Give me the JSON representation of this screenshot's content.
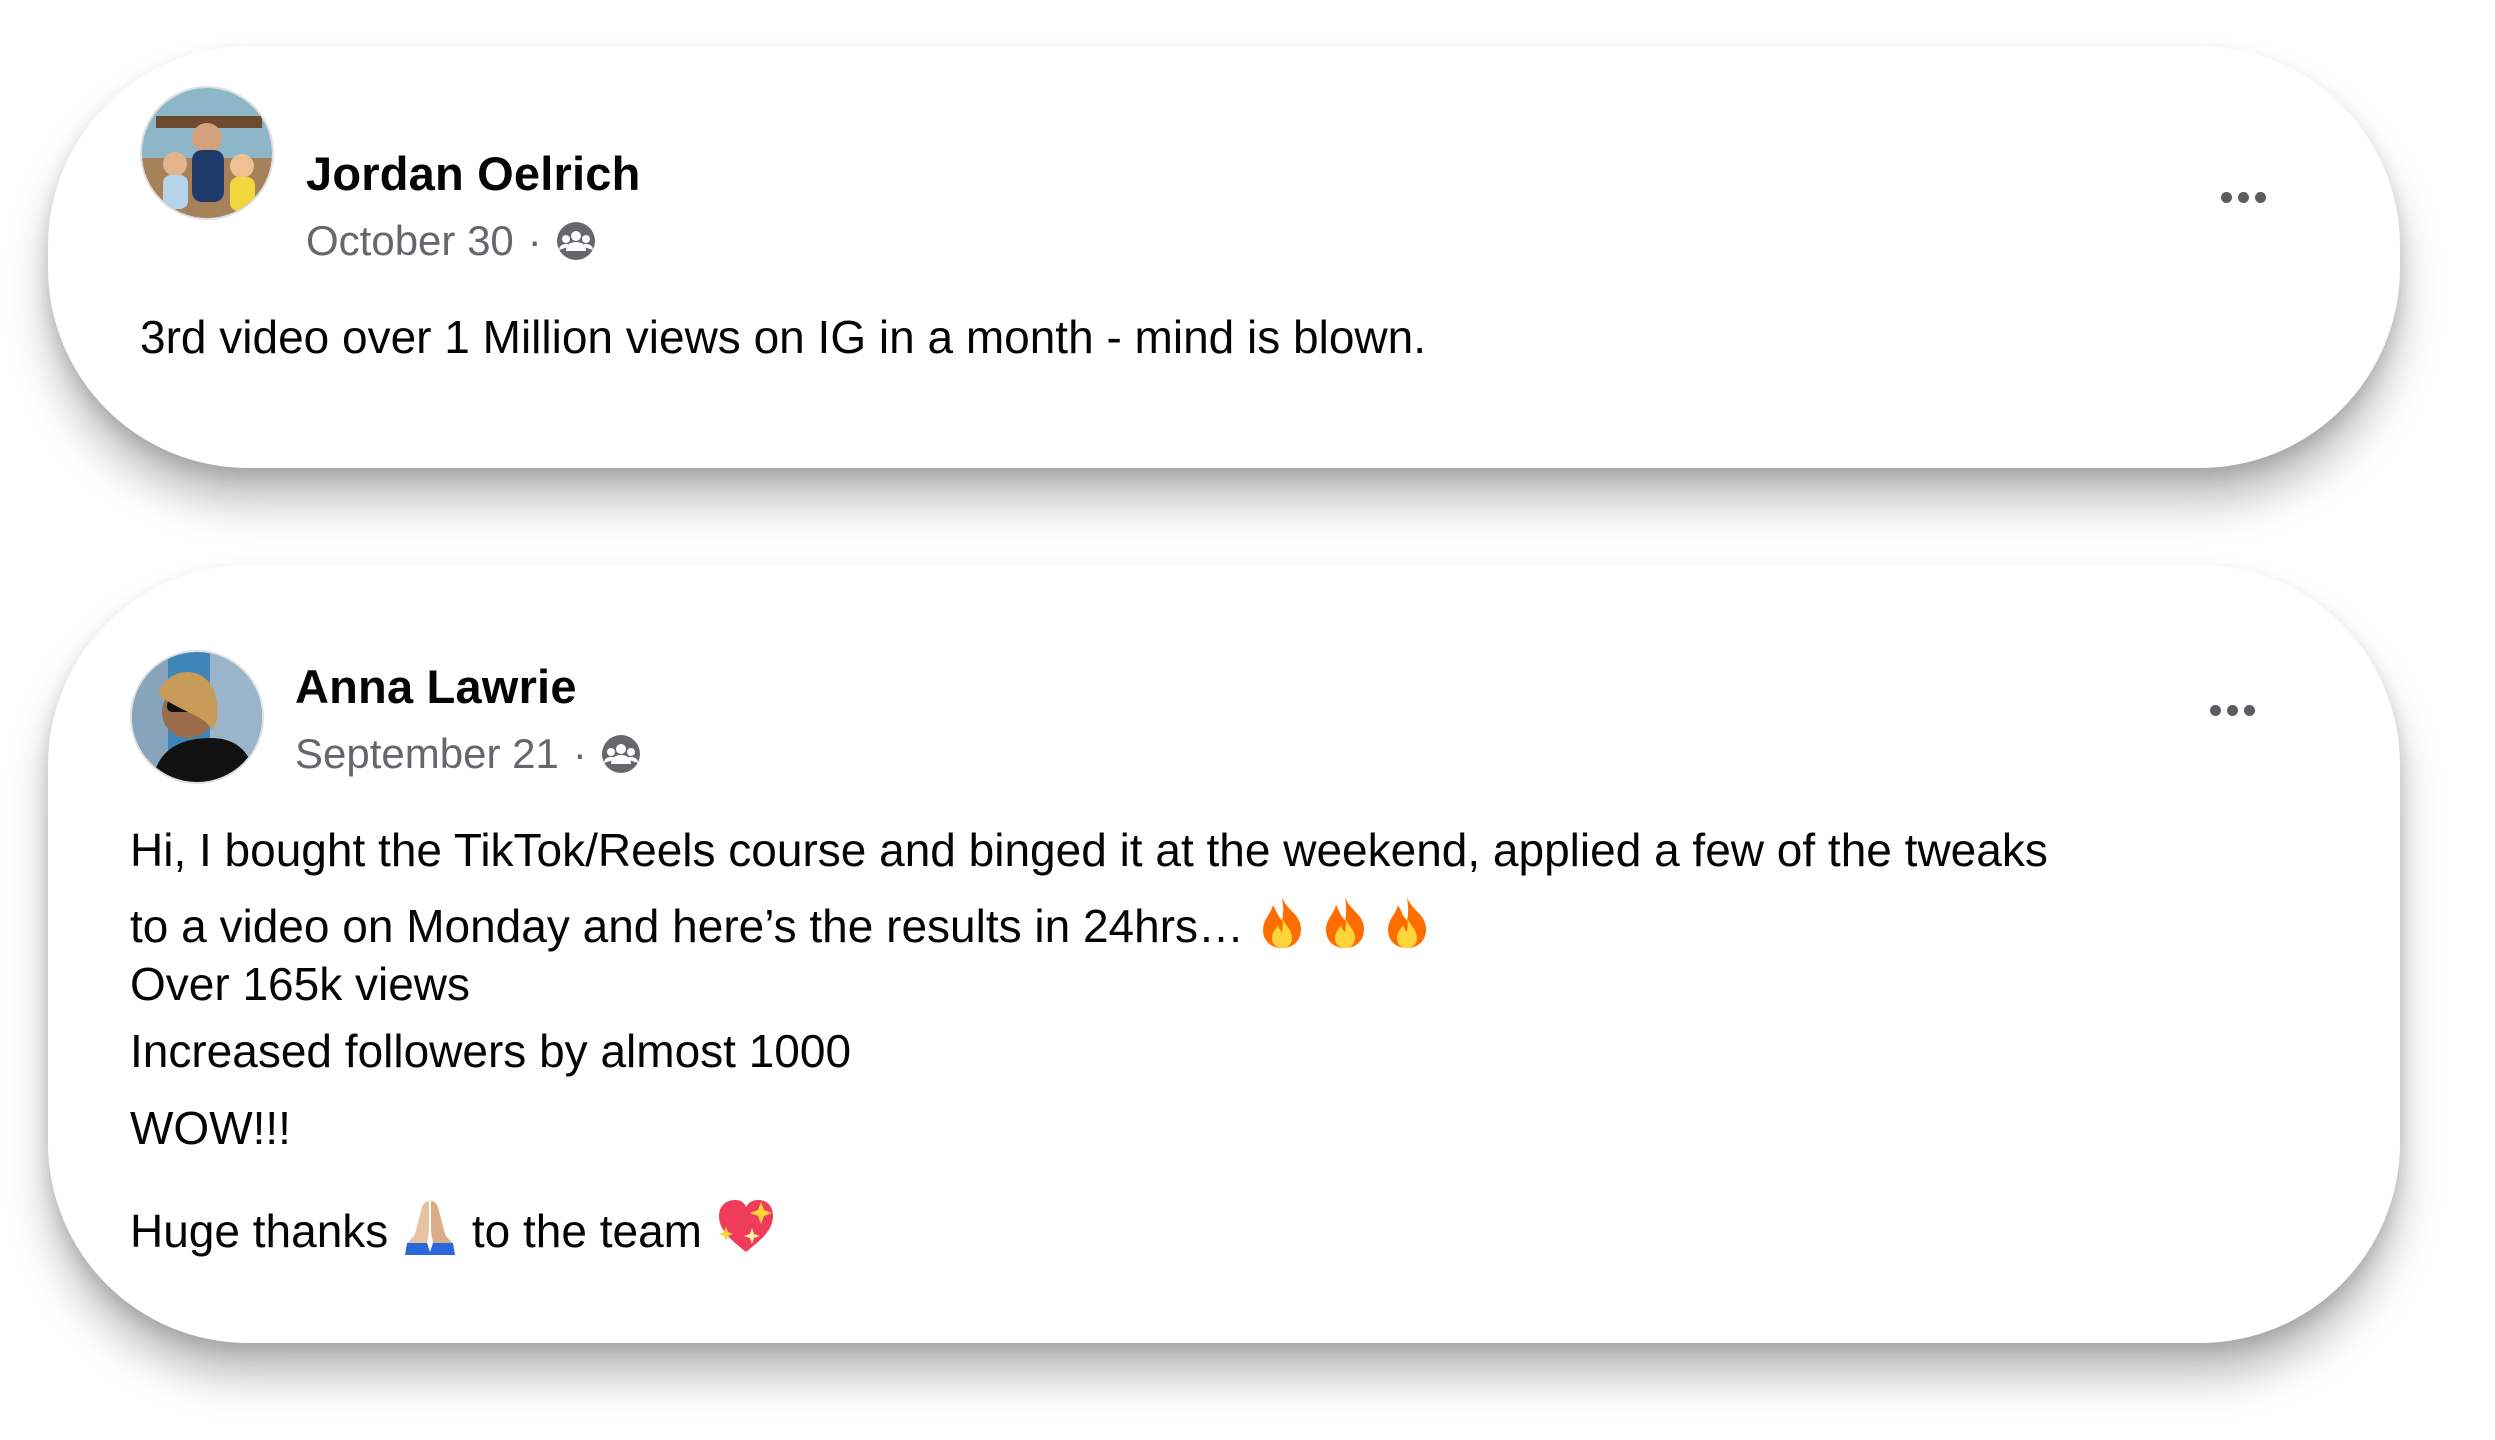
{
  "posts": [
    {
      "author": "Jordan Oelrich",
      "date": "October 30",
      "separator": "·",
      "audience_icon": "group-icon",
      "text": "3rd video over 1 Million views on IG in a month - mind is blown."
    },
    {
      "author": "Anna Lawrie",
      "date": "September 21",
      "separator": "·",
      "audience_icon": "group-icon",
      "lines": {
        "line1": "Hi, I bought the TikTok/Reels course and binged it at the  weekend, applied a few of the tweaks",
        "line2": "to a video on Monday and here’s the results in 24hrs…",
        "line3": "Over 165k views",
        "line4": "Increased followers by almost 1000",
        "line5": "WOW!!!",
        "line6_a": "Huge thanks ",
        "line6_b": " to the team "
      },
      "emojis": [
        "fire-emoji",
        "fire-emoji",
        "fire-emoji",
        "folded-hands-emoji",
        "sparkling-heart-emoji"
      ]
    }
  ],
  "colors": {
    "primary_text": "#050505",
    "secondary_text": "#65676b",
    "more_dots": "#5b5d61",
    "card_background": "#ffffff"
  }
}
